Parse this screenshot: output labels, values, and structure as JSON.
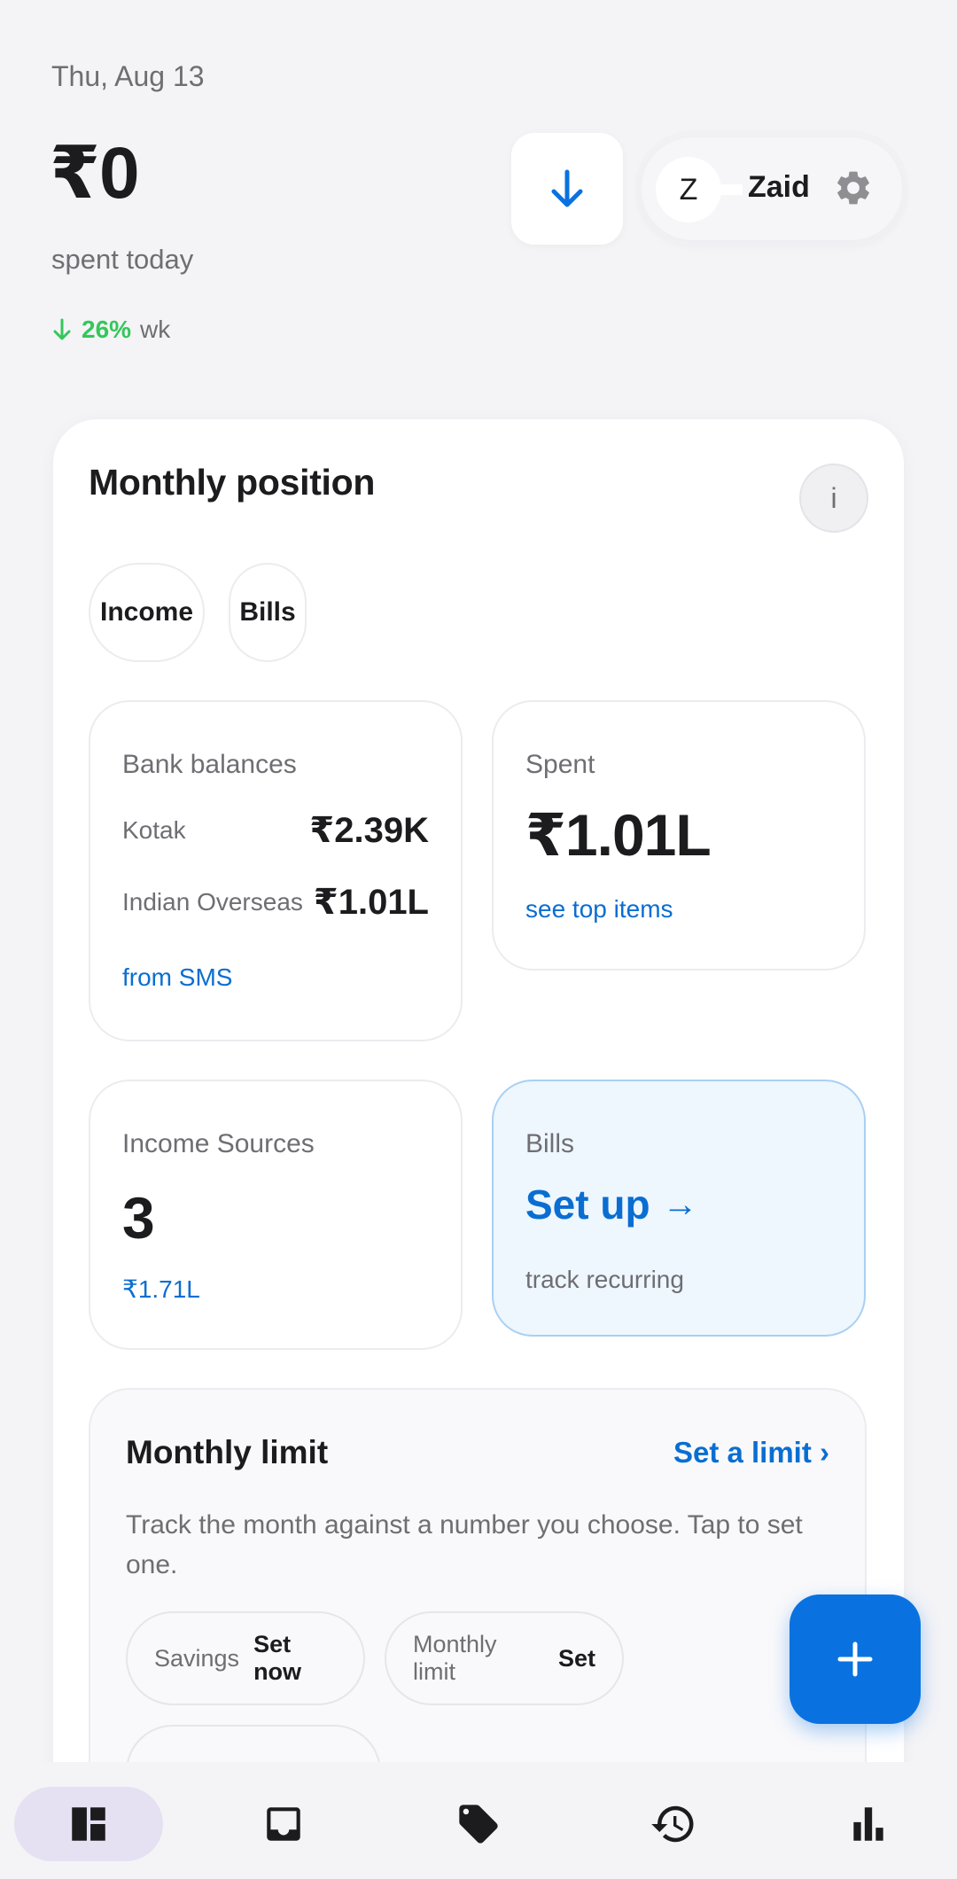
{
  "header": {
    "date": "Thu, Aug 13",
    "spent_amount": "₹0",
    "spent_label": "spent today",
    "trend_pct": "26%",
    "trend_unit": "wk"
  },
  "profile": {
    "initial": "Z",
    "name": "Zaid"
  },
  "monthly_position": {
    "title": "Monthly position",
    "info_label": "i",
    "chips": [
      "Income",
      "Bills"
    ],
    "bank_balances": {
      "label": "Bank balances",
      "rows": [
        {
          "name": "Kotak",
          "amount": "₹2.39K"
        },
        {
          "name": "Indian Overseas",
          "amount": "₹1.01L"
        }
      ],
      "link": "from SMS"
    },
    "spent": {
      "label": "Spent",
      "amount": "₹1.01L",
      "link": "see top items"
    },
    "income_sources": {
      "label": "Income Sources",
      "count": "3",
      "amount": "₹1.71L"
    },
    "bills": {
      "label": "Bills",
      "action": "Set up",
      "arrow": "→",
      "subtitle": "track recurring"
    }
  },
  "monthly_limit": {
    "title": "Monthly limit",
    "link": "Set a limit ›",
    "description": "Track the month against a number you choose. Tap to set one.",
    "goals": [
      {
        "label": "Savings",
        "action": "Set now"
      },
      {
        "label": "Monthly limit",
        "action": "Set"
      }
    ]
  },
  "colors": {
    "accent": "#0a72e0",
    "link": "#0a6ed1",
    "positive": "#34c759",
    "nav_active": "#e5e1f2"
  },
  "icons": {
    "download": "arrow-down-icon",
    "settings": "gear-icon",
    "fab": "plus-icon",
    "nav": [
      "dashboard-icon",
      "inbox-icon",
      "tag-icon",
      "history-icon",
      "bar-chart-icon"
    ]
  }
}
